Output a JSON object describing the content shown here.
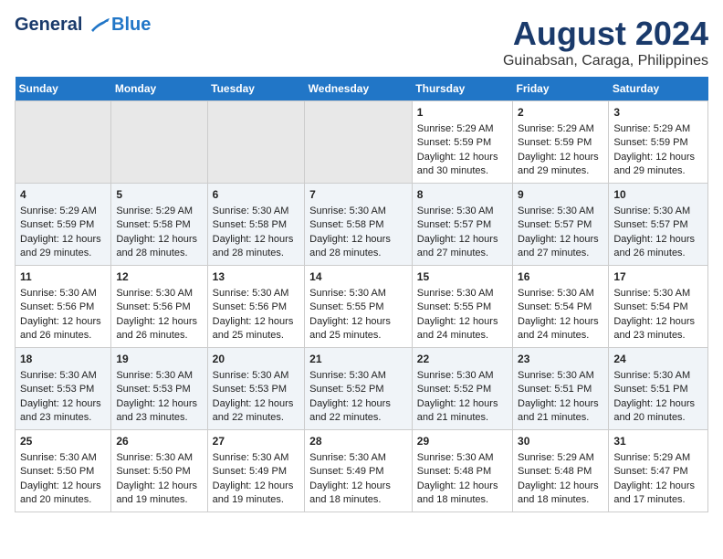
{
  "header": {
    "logo_line1": "General",
    "logo_line2": "Blue",
    "main_title": "August 2024",
    "subtitle": "Guinabsan, Caraga, Philippines"
  },
  "calendar": {
    "days_of_week": [
      "Sunday",
      "Monday",
      "Tuesday",
      "Wednesday",
      "Thursday",
      "Friday",
      "Saturday"
    ],
    "weeks": [
      [
        {
          "day": "",
          "info": ""
        },
        {
          "day": "",
          "info": ""
        },
        {
          "day": "",
          "info": ""
        },
        {
          "day": "",
          "info": ""
        },
        {
          "day": "1",
          "info": "Sunrise: 5:29 AM\nSunset: 5:59 PM\nDaylight: 12 hours and 30 minutes."
        },
        {
          "day": "2",
          "info": "Sunrise: 5:29 AM\nSunset: 5:59 PM\nDaylight: 12 hours and 29 minutes."
        },
        {
          "day": "3",
          "info": "Sunrise: 5:29 AM\nSunset: 5:59 PM\nDaylight: 12 hours and 29 minutes."
        }
      ],
      [
        {
          "day": "4",
          "info": "Sunrise: 5:29 AM\nSunset: 5:59 PM\nDaylight: 12 hours and 29 minutes."
        },
        {
          "day": "5",
          "info": "Sunrise: 5:29 AM\nSunset: 5:58 PM\nDaylight: 12 hours and 28 minutes."
        },
        {
          "day": "6",
          "info": "Sunrise: 5:30 AM\nSunset: 5:58 PM\nDaylight: 12 hours and 28 minutes."
        },
        {
          "day": "7",
          "info": "Sunrise: 5:30 AM\nSunset: 5:58 PM\nDaylight: 12 hours and 28 minutes."
        },
        {
          "day": "8",
          "info": "Sunrise: 5:30 AM\nSunset: 5:57 PM\nDaylight: 12 hours and 27 minutes."
        },
        {
          "day": "9",
          "info": "Sunrise: 5:30 AM\nSunset: 5:57 PM\nDaylight: 12 hours and 27 minutes."
        },
        {
          "day": "10",
          "info": "Sunrise: 5:30 AM\nSunset: 5:57 PM\nDaylight: 12 hours and 26 minutes."
        }
      ],
      [
        {
          "day": "11",
          "info": "Sunrise: 5:30 AM\nSunset: 5:56 PM\nDaylight: 12 hours and 26 minutes."
        },
        {
          "day": "12",
          "info": "Sunrise: 5:30 AM\nSunset: 5:56 PM\nDaylight: 12 hours and 26 minutes."
        },
        {
          "day": "13",
          "info": "Sunrise: 5:30 AM\nSunset: 5:56 PM\nDaylight: 12 hours and 25 minutes."
        },
        {
          "day": "14",
          "info": "Sunrise: 5:30 AM\nSunset: 5:55 PM\nDaylight: 12 hours and 25 minutes."
        },
        {
          "day": "15",
          "info": "Sunrise: 5:30 AM\nSunset: 5:55 PM\nDaylight: 12 hours and 24 minutes."
        },
        {
          "day": "16",
          "info": "Sunrise: 5:30 AM\nSunset: 5:54 PM\nDaylight: 12 hours and 24 minutes."
        },
        {
          "day": "17",
          "info": "Sunrise: 5:30 AM\nSunset: 5:54 PM\nDaylight: 12 hours and 23 minutes."
        }
      ],
      [
        {
          "day": "18",
          "info": "Sunrise: 5:30 AM\nSunset: 5:53 PM\nDaylight: 12 hours and 23 minutes."
        },
        {
          "day": "19",
          "info": "Sunrise: 5:30 AM\nSunset: 5:53 PM\nDaylight: 12 hours and 23 minutes."
        },
        {
          "day": "20",
          "info": "Sunrise: 5:30 AM\nSunset: 5:53 PM\nDaylight: 12 hours and 22 minutes."
        },
        {
          "day": "21",
          "info": "Sunrise: 5:30 AM\nSunset: 5:52 PM\nDaylight: 12 hours and 22 minutes."
        },
        {
          "day": "22",
          "info": "Sunrise: 5:30 AM\nSunset: 5:52 PM\nDaylight: 12 hours and 21 minutes."
        },
        {
          "day": "23",
          "info": "Sunrise: 5:30 AM\nSunset: 5:51 PM\nDaylight: 12 hours and 21 minutes."
        },
        {
          "day": "24",
          "info": "Sunrise: 5:30 AM\nSunset: 5:51 PM\nDaylight: 12 hours and 20 minutes."
        }
      ],
      [
        {
          "day": "25",
          "info": "Sunrise: 5:30 AM\nSunset: 5:50 PM\nDaylight: 12 hours and 20 minutes."
        },
        {
          "day": "26",
          "info": "Sunrise: 5:30 AM\nSunset: 5:50 PM\nDaylight: 12 hours and 19 minutes."
        },
        {
          "day": "27",
          "info": "Sunrise: 5:30 AM\nSunset: 5:49 PM\nDaylight: 12 hours and 19 minutes."
        },
        {
          "day": "28",
          "info": "Sunrise: 5:30 AM\nSunset: 5:49 PM\nDaylight: 12 hours and 18 minutes."
        },
        {
          "day": "29",
          "info": "Sunrise: 5:30 AM\nSunset: 5:48 PM\nDaylight: 12 hours and 18 minutes."
        },
        {
          "day": "30",
          "info": "Sunrise: 5:29 AM\nSunset: 5:48 PM\nDaylight: 12 hours and 18 minutes."
        },
        {
          "day": "31",
          "info": "Sunrise: 5:29 AM\nSunset: 5:47 PM\nDaylight: 12 hours and 17 minutes."
        }
      ]
    ]
  }
}
